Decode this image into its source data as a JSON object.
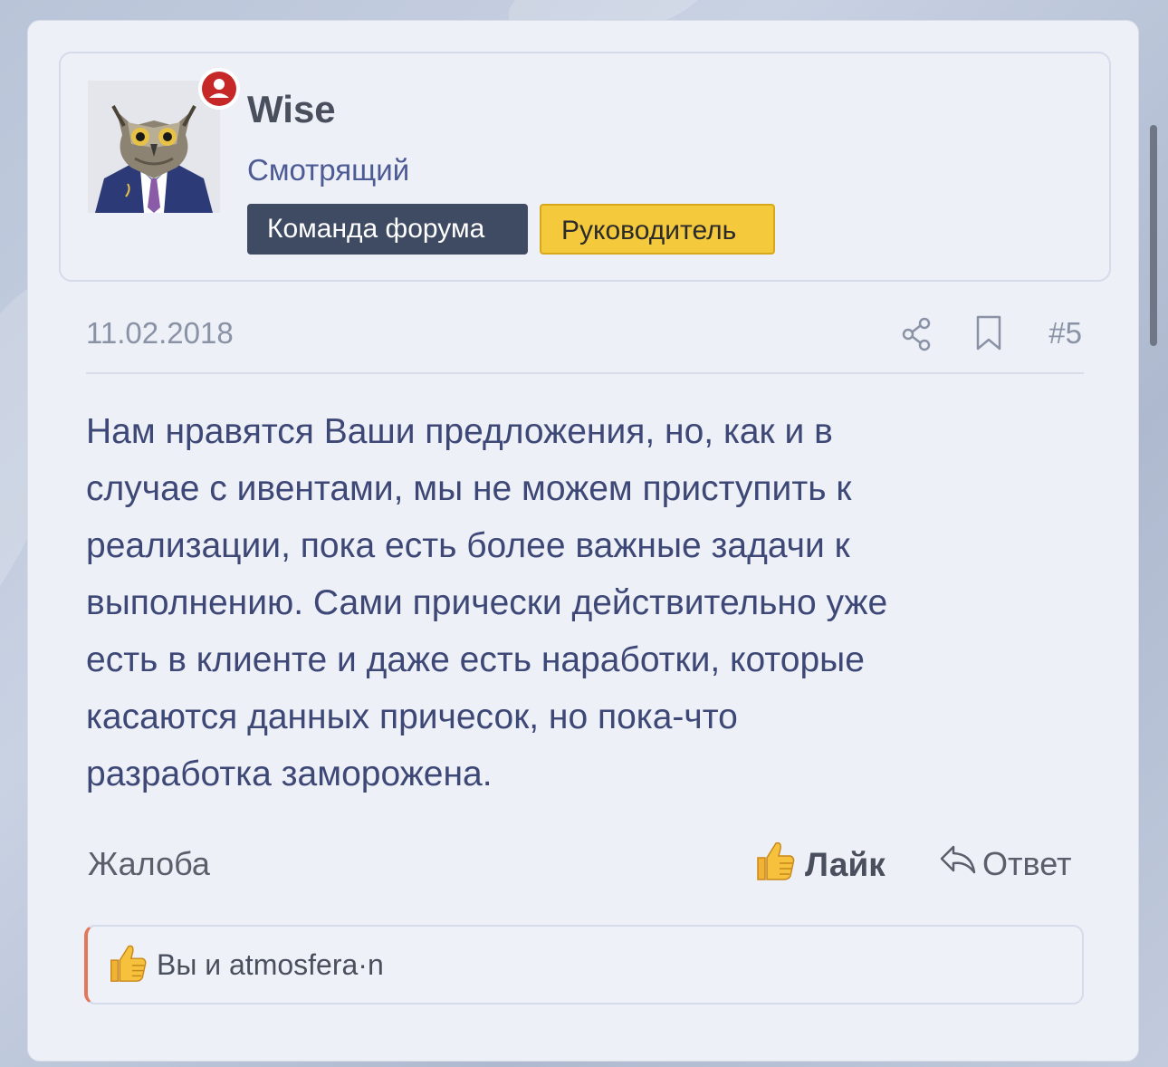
{
  "user": {
    "name": "Wise",
    "title": "Смотрящий",
    "badges": [
      "Команда форума",
      "Руководитель"
    ]
  },
  "post": {
    "date": "11.02.2018",
    "number": "#5",
    "body": "Нам нравятся Ваши предложения, но, как и в\nслучае с ивентами, мы не можем приступить к\nреализации, пока есть более важные задачи к\nвыполнению. Сами прически действительно уже\nесть в клиенте и даже есть наработки, которые\nкасаются данных причесок, но пока-что\nразработка заморожена."
  },
  "actions": {
    "report": "Жалоба",
    "like": "Лайк",
    "reply": "Ответ"
  },
  "likes": {
    "text": "Вы и atmosfera·n"
  },
  "icons": {
    "status": "user-circle-icon",
    "share": "share-icon",
    "bookmark": "bookmark-icon",
    "like": "thumbs-up-icon",
    "reply": "reply-icon"
  },
  "colors": {
    "card_bg": "#eef0f7",
    "team_badge": "#3f4b62",
    "lead_badge": "#f4c93b",
    "status_red": "#c62828",
    "text_blue": "#3d4877",
    "likes_accent": "#e2785b"
  }
}
